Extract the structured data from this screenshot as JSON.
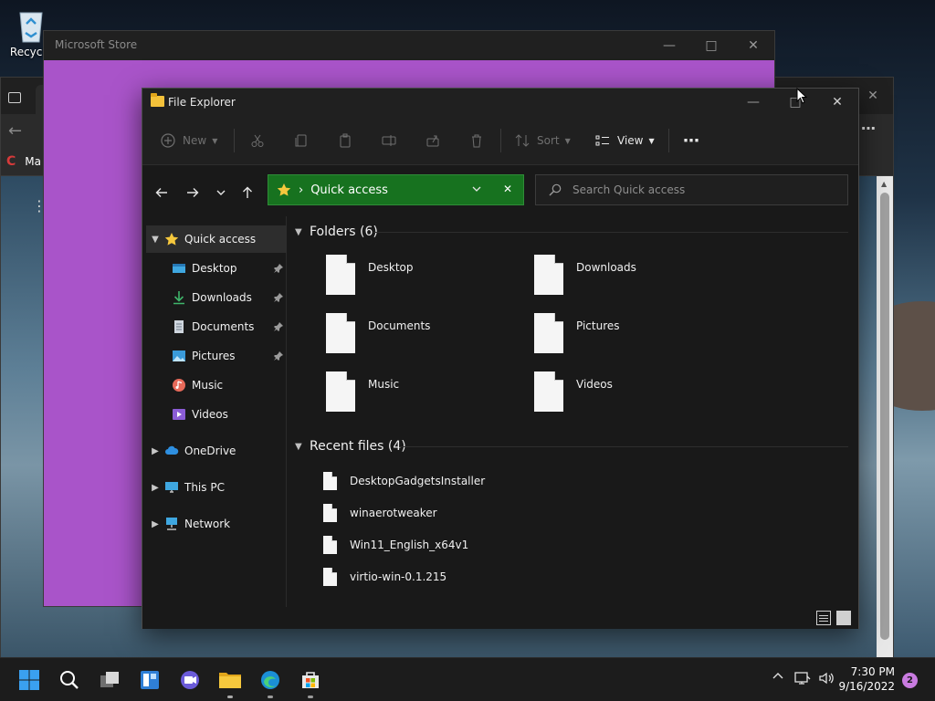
{
  "desktop": {
    "recycle_bin_label": "Recycle"
  },
  "browser": {
    "bookmark_label": "Ma",
    "more_glyph": "⋯"
  },
  "store": {
    "title": "Microsoft Store",
    "minimize_glyph": "—",
    "maximize_glyph": "□",
    "close_glyph": "✕"
  },
  "explorer": {
    "title": "File Explorer",
    "minimize_glyph": "—",
    "maximize_glyph": "□",
    "close_glyph": "✕",
    "toolbar": {
      "new_label": "New",
      "sort_label": "Sort",
      "view_label": "View",
      "more_glyph": "⋯"
    },
    "address": {
      "current": "Quick access",
      "separator": "›"
    },
    "search": {
      "placeholder": "Search Quick access"
    },
    "nav": {
      "quick_access": "Quick access",
      "pinned": [
        {
          "label": "Desktop"
        },
        {
          "label": "Downloads"
        },
        {
          "label": "Documents"
        },
        {
          "label": "Pictures"
        }
      ],
      "music": "Music",
      "videos": "Videos",
      "onedrive": "OneDrive",
      "this_pc": "This PC",
      "network": "Network"
    },
    "folders_header": "Folders (6)",
    "folders": [
      {
        "name": "Desktop"
      },
      {
        "name": "Downloads"
      },
      {
        "name": "Documents"
      },
      {
        "name": "Pictures"
      },
      {
        "name": "Music"
      },
      {
        "name": "Videos"
      }
    ],
    "recent_header": "Recent files (4)",
    "recent_files": [
      {
        "name": "DesktopGadgetsInstaller"
      },
      {
        "name": "winaerotweaker"
      },
      {
        "name": "Win11_English_x64v1"
      },
      {
        "name": "virtio-win-0.1.215"
      }
    ]
  },
  "taskbar": {
    "time": "7:30 PM",
    "date": "9/16/2022",
    "notification_count": "2"
  },
  "colors": {
    "address_bg": "#17721f",
    "store_bg": "#a954c9",
    "folder_icon": "#f3c13a",
    "accent_badge": "#c97be0"
  }
}
